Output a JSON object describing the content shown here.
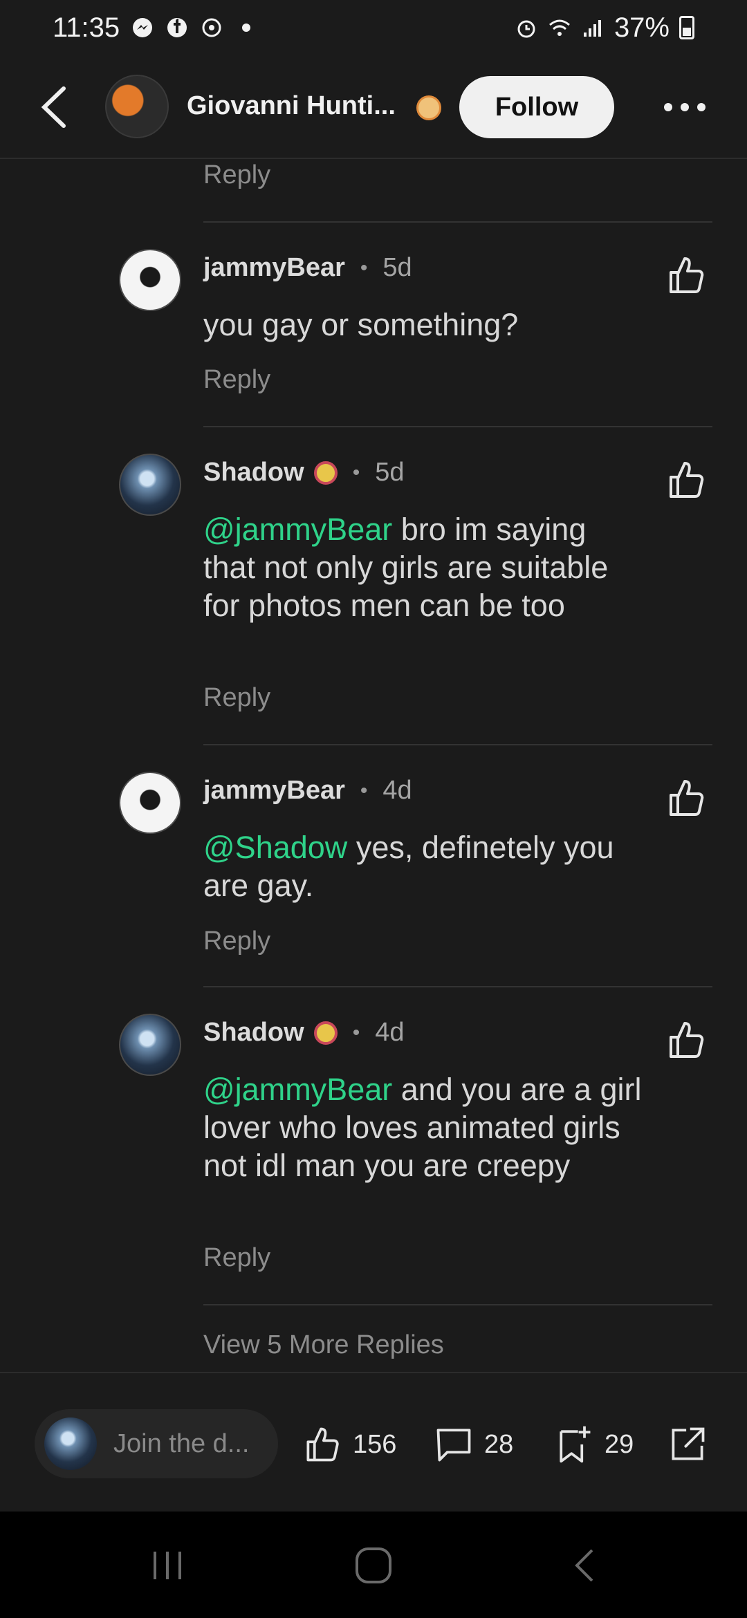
{
  "status": {
    "time": "11:35",
    "battery": "37%"
  },
  "header": {
    "name": "Giovanni Hunti...",
    "follow_label": "Follow"
  },
  "thread": {
    "top_reply_label": "Reply",
    "comments": [
      {
        "user": "jammyBear",
        "time": "5d",
        "mention": "",
        "text": "you gay or something?",
        "reply_label": "Reply"
      },
      {
        "user": "Shadow",
        "time": "5d",
        "mention": "@jammyBear",
        "text": " bro im saying that not only girls are suitable for photos men can be too",
        "reply_label": "Reply"
      },
      {
        "user": "jammyBear",
        "time": "4d",
        "mention": "@Shadow",
        "text": " yes, definetely you are gay.",
        "reply_label": "Reply"
      },
      {
        "user": "Shadow",
        "time": "4d",
        "mention": "@jammyBear",
        "text": " and you are a girl lover who loves animated girls not idl man you are creepy",
        "reply_label": "Reply"
      }
    ],
    "view_more": "View 5 More Replies"
  },
  "bottom_bar": {
    "compose_placeholder": "Join the d...",
    "likes": "156",
    "comments": "28",
    "saves": "29"
  },
  "icons": {
    "mention_color": "#2fd38a"
  }
}
